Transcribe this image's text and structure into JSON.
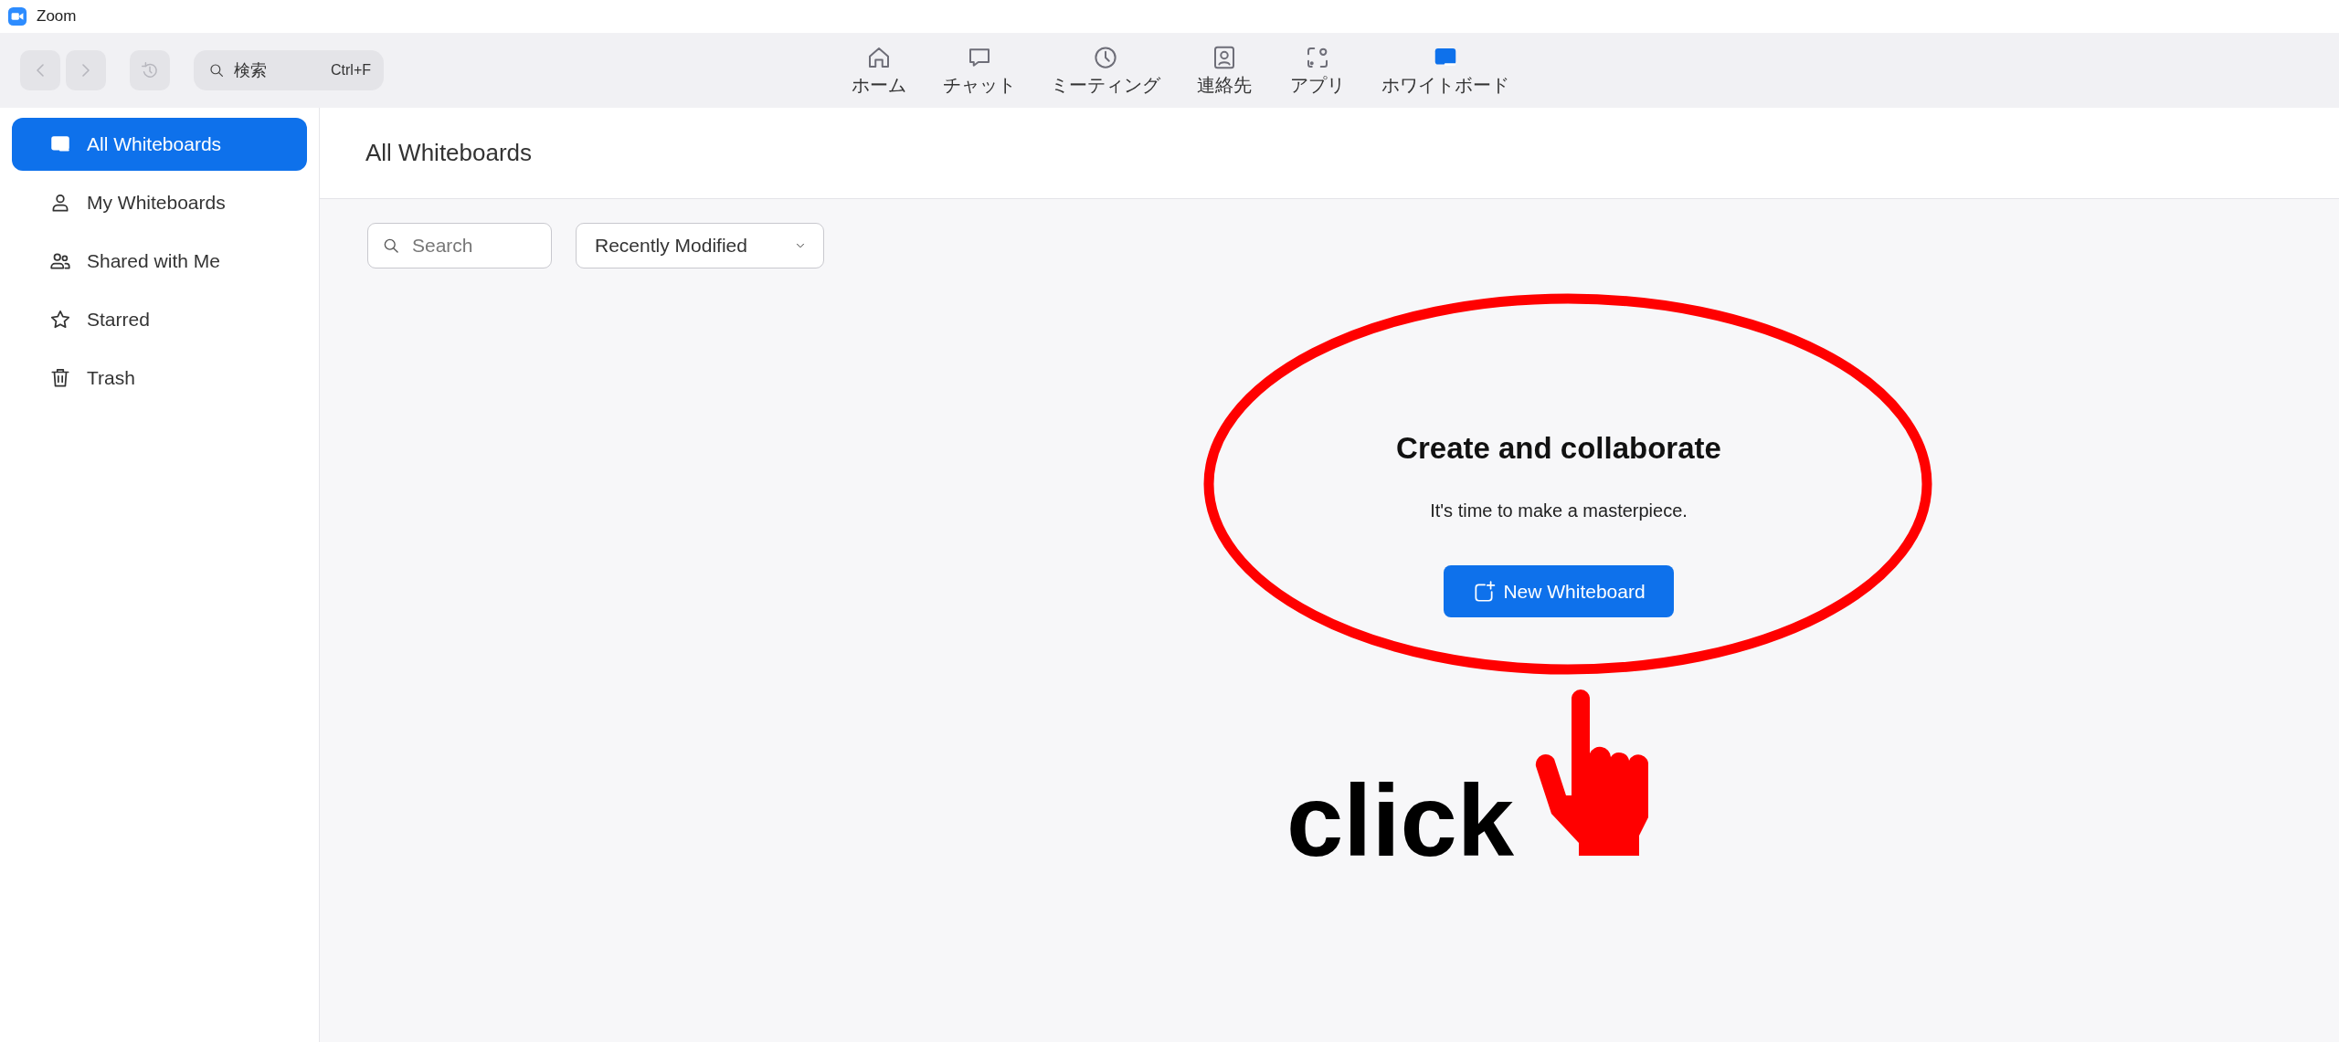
{
  "window": {
    "title": "Zoom"
  },
  "toolbar": {
    "search": {
      "placeholder": "検索",
      "shortcut": "Ctrl+F"
    },
    "tabs": [
      {
        "label": "ホーム",
        "kind": "home",
        "selected": false
      },
      {
        "label": "チャット",
        "kind": "chat",
        "selected": false
      },
      {
        "label": "ミーティング",
        "kind": "clock",
        "selected": false
      },
      {
        "label": "連絡先",
        "kind": "contact",
        "selected": false
      },
      {
        "label": "アプリ",
        "kind": "apps",
        "selected": false
      },
      {
        "label": "ホワイトボード",
        "kind": "whiteboard",
        "selected": true
      }
    ]
  },
  "sidebar": {
    "items": [
      {
        "label": "All Whiteboards",
        "kind": "whiteboard",
        "selected": true
      },
      {
        "label": "My Whiteboards",
        "kind": "person",
        "selected": false
      },
      {
        "label": "Shared with Me",
        "kind": "people",
        "selected": false
      },
      {
        "label": "Starred",
        "kind": "star",
        "selected": false
      },
      {
        "label": "Trash",
        "kind": "trash",
        "selected": false
      }
    ]
  },
  "main": {
    "title": "All Whiteboards",
    "search": {
      "placeholder": "Search"
    },
    "sort": {
      "value": "Recently Modified"
    },
    "empty_state": {
      "heading": "Create and collaborate",
      "text": "It's time to make a masterpiece.",
      "button": "New Whiteboard"
    }
  },
  "annotation": {
    "text": "click"
  }
}
